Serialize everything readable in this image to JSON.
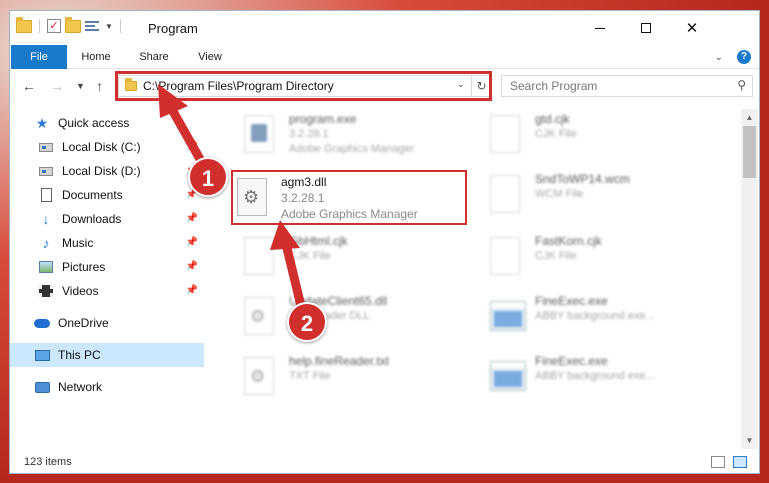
{
  "window": {
    "title": "Program",
    "controls": {
      "minimize": "—",
      "maximize": "",
      "close": "✕"
    }
  },
  "ribbon": {
    "tabs": [
      "File",
      "Home",
      "Share",
      "View"
    ],
    "help": "?"
  },
  "nav": {
    "address": "C:\\Program Files\\Program Directory",
    "search_placeholder": "Search Program"
  },
  "sidebar": {
    "items": [
      {
        "label": "Quick access",
        "icon": "star-icon"
      },
      {
        "label": "Local Disk (C:)",
        "icon": "drive-icon"
      },
      {
        "label": "Local Disk (D:)",
        "icon": "drive-icon"
      },
      {
        "label": "Documents",
        "icon": "document-icon"
      },
      {
        "label": "Downloads",
        "icon": "download-icon"
      },
      {
        "label": "Music",
        "icon": "music-icon"
      },
      {
        "label": "Pictures",
        "icon": "pictures-icon"
      },
      {
        "label": "Videos",
        "icon": "videos-icon"
      },
      {
        "label": "OneDrive",
        "icon": "cloud-icon"
      },
      {
        "label": "This PC",
        "icon": "computer-icon"
      },
      {
        "label": "Network",
        "icon": "network-icon"
      }
    ]
  },
  "files": {
    "highlighted": {
      "name": "agm3.dll",
      "version": "3.2.28.1",
      "description": "Adobe Graphics Manager"
    },
    "left": [
      {
        "name": "program.exe",
        "line1": "3.2.28.1",
        "line2": "Adobe Graphics Manager"
      },
      {
        "name": "GbHtml.cjk",
        "line1": "CJK File",
        "line2": ""
      },
      {
        "name": "UpdateClient65.dll",
        "line1": "FineReader DLL",
        "line2": ""
      },
      {
        "name": "help.fineReader.txt",
        "line1": "TXT File",
        "line2": ""
      }
    ],
    "right": [
      {
        "name": "gtd.cjk",
        "line1": "CJK File",
        "line2": ""
      },
      {
        "name": "SndToWP14.wcm",
        "line1": "WCM File",
        "line2": ""
      },
      {
        "name": "FastKorn.cjk",
        "line1": "CJK File",
        "line2": ""
      },
      {
        "name": "FineExec.exe",
        "line1": "ABBY background exe...",
        "line2": ""
      },
      {
        "name": "FineExec.exe",
        "line1": "ABBY background exe...",
        "line2": ""
      }
    ]
  },
  "status": {
    "count": "123 items"
  },
  "annotations": {
    "step1": "1",
    "step2": "2"
  },
  "colors": {
    "accent": "#1979ca",
    "annotation": "#d12e2e",
    "selected": "#cce8ff"
  }
}
